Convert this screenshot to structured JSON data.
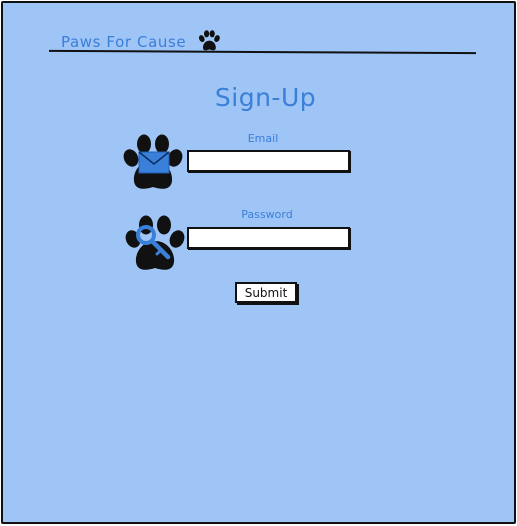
{
  "header": {
    "brand": "Paws For Cause",
    "brand_icon": "paw-icon"
  },
  "page": {
    "title": "Sign-Up"
  },
  "form": {
    "email_label": "Email",
    "email_value": "",
    "password_label": "Password",
    "password_value": "",
    "submit_label": "Submit"
  },
  "colors": {
    "background": "#9fc4f6",
    "accent": "#3a7fd8",
    "ink": "#111111"
  }
}
